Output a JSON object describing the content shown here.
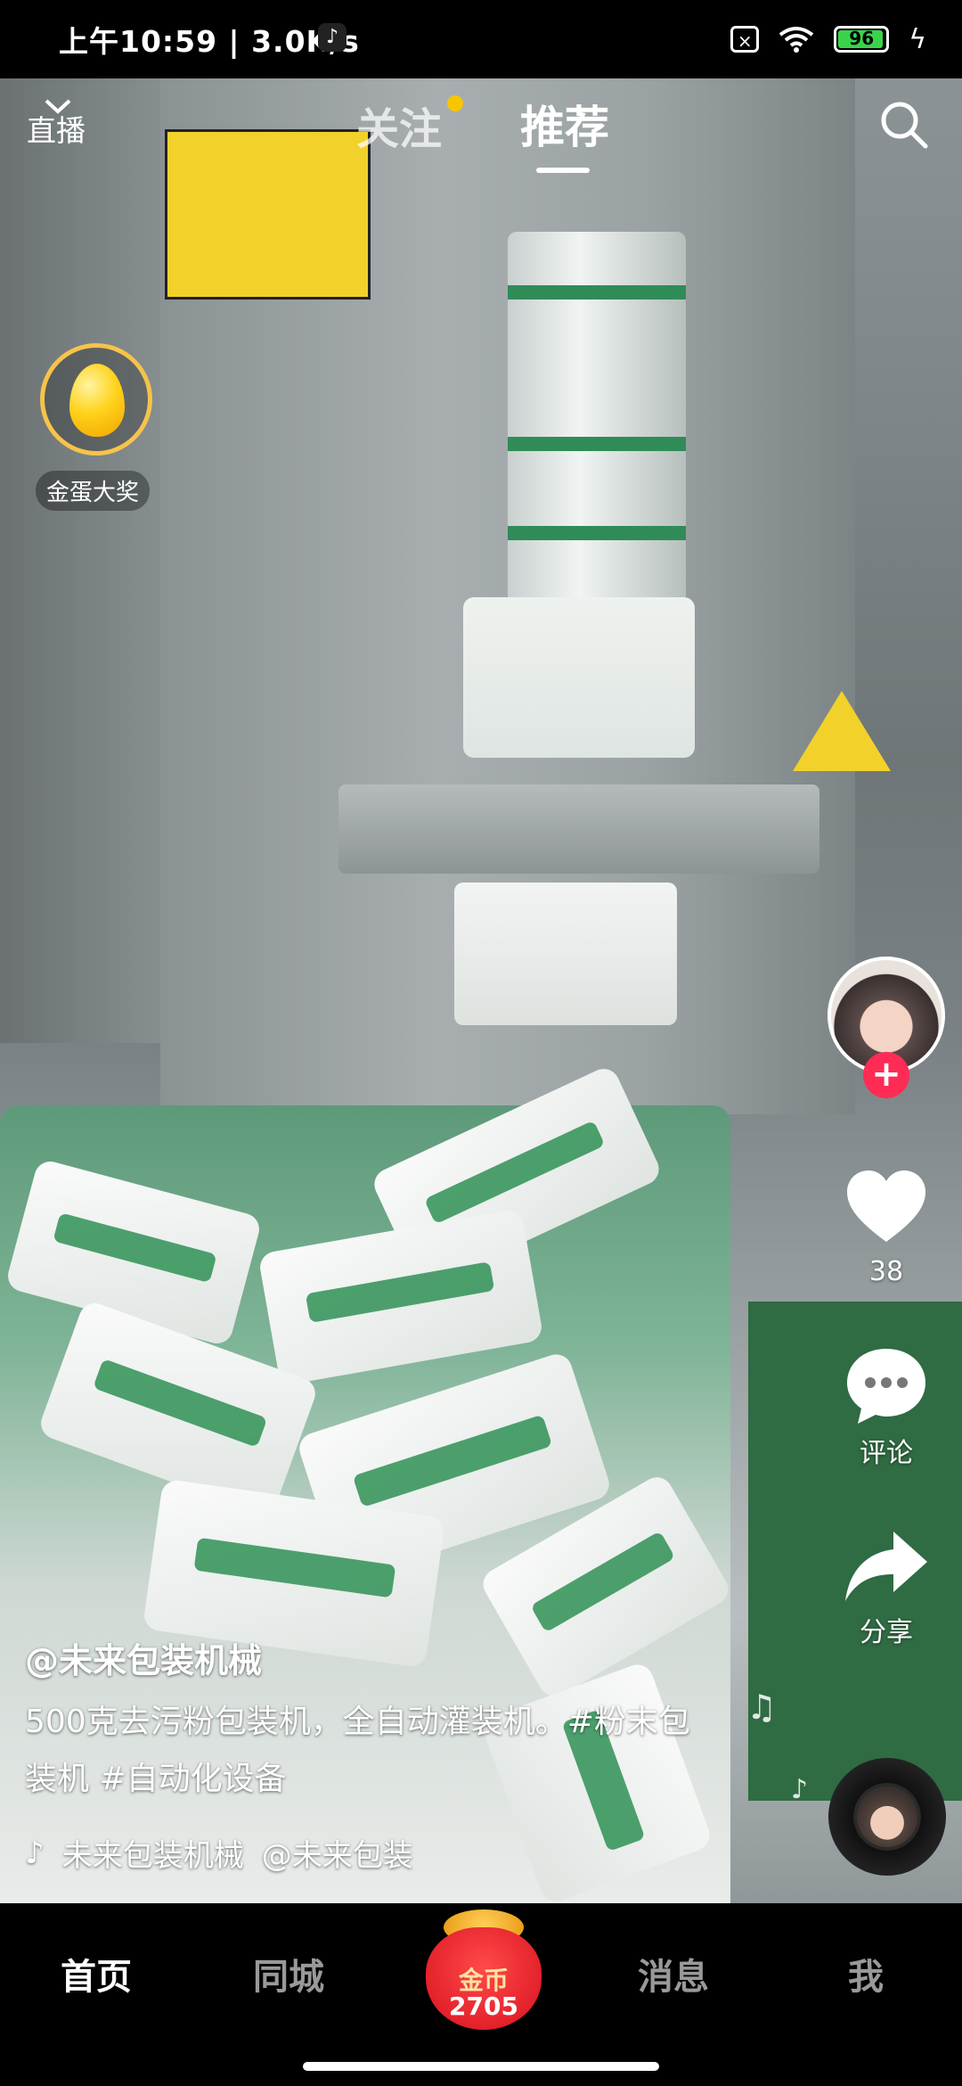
{
  "status_bar": {
    "time_speed": "上午10:59 | 3.0K/s",
    "battery": "96",
    "battery_level": 0.96,
    "icons": [
      "tiktok-icon",
      "sim-x-icon",
      "wifi-icon",
      "battery-icon",
      "charging-icon"
    ]
  },
  "top_nav": {
    "live_label": "直播",
    "tab_follow": "关注",
    "tab_recommend": "推荐",
    "active_tab": "推荐",
    "follow_has_dot": true,
    "dot_color": "#f7c600"
  },
  "golden_egg": {
    "label": "金蛋大奖"
  },
  "right_rail": {
    "like_count": "38",
    "comment_label": "评论",
    "share_label": "分享",
    "follow_plus_color": "#fe2c55"
  },
  "caption": {
    "username": "@未来包装机械",
    "text": "500克去污粉包装机，全自动灌装机。#粉末包装机 #自动化设备",
    "music_title": "未来包装机械",
    "music_author": "@未来包装"
  },
  "bottom_nav": {
    "home": "首页",
    "nearby": "同城",
    "coin_label": "金币",
    "coin_count": "2705",
    "messages": "消息",
    "me": "我",
    "active": "首页"
  }
}
